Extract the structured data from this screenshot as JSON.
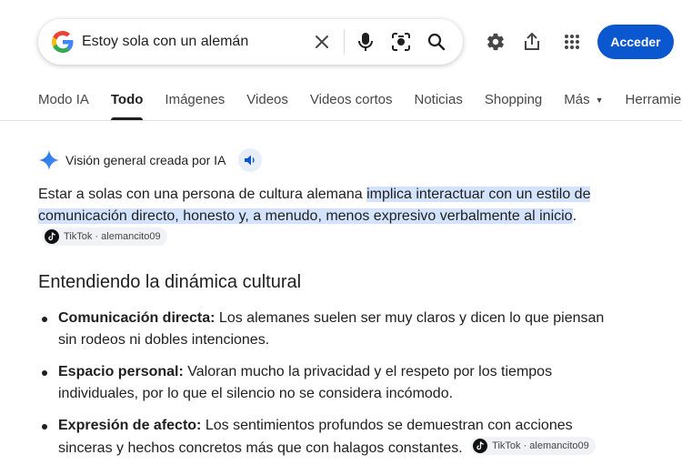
{
  "search": {
    "query": "Estoy sola con un alemán",
    "icons": [
      "google-g-logo",
      "clear-icon",
      "microphone-icon",
      "lens-camera-icon",
      "search-icon"
    ]
  },
  "top_icons": [
    "settings-gear-icon",
    "share-icon",
    "apps-grid-icon"
  ],
  "signin_label": "Acceder",
  "tabs": [
    {
      "label": "Modo IA"
    },
    {
      "label": "Todo",
      "active": true
    },
    {
      "label": "Imágenes"
    },
    {
      "label": "Videos"
    },
    {
      "label": "Videos cortos"
    },
    {
      "label": "Noticias"
    },
    {
      "label": "Shopping"
    },
    {
      "label": "Más"
    },
    {
      "label": "Herramientas"
    }
  ],
  "ai_overview": {
    "title": "Visión general creada por IA",
    "intro_plain": "Estar a solas con una persona de cultura alemana ",
    "intro_highlight": "implica interactuar con un estilo de comunicación directo, honesto y, a menudo, menos expresivo verbalmente al inicio",
    "intro_end": ".",
    "source_chip": "TikTok · alemancito09",
    "section_heading": "Entendiendo la dinámica cultural",
    "bullets": [
      {
        "term": "Comunicación directa:",
        "text": " Los alemanes suelen ser muy claros y dicen lo que piensan sin rodeos ni dobles intenciones."
      },
      {
        "term": "Espacio personal:",
        "text": " Valoran mucho la privacidad y el respeto por los tiempos individuales, por lo que el silencio no se considera incómodo."
      },
      {
        "term": "Expresión de afecto:",
        "text": " Los sentimientos profundos se demuestran con acciones sinceras y hechos concretos más que con halagos constantes.",
        "chip": "TikTok · alemancito09"
      }
    ]
  },
  "colors": {
    "accent_blue": "#0b57d0",
    "highlight": "#d3e3fd",
    "text": "#1f1f1f",
    "muted": "#474747"
  }
}
